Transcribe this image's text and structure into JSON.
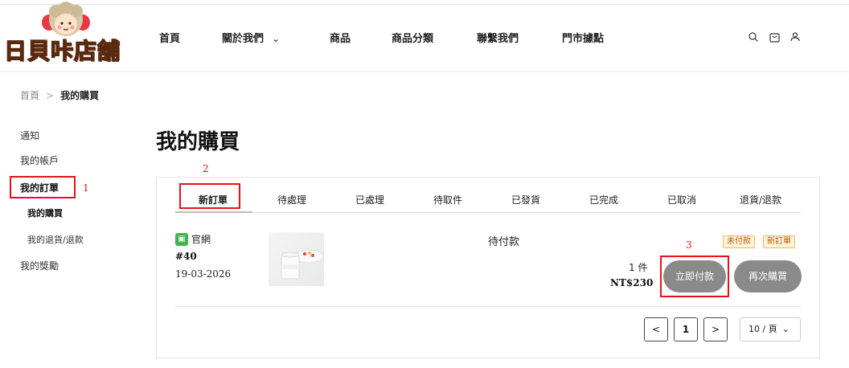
{
  "brand": {
    "logo_text": "日貝咔店舖",
    "accent": "#e53a46"
  },
  "nav": {
    "items": [
      {
        "label": "首頁"
      },
      {
        "label": "關於我們"
      },
      {
        "label": "商品"
      },
      {
        "label": "商品分類"
      },
      {
        "label": "聯繫我們"
      },
      {
        "label": "門市據點"
      }
    ],
    "dropdown_icon": "chevron-down-icon",
    "icons": [
      "search-icon",
      "cart-icon",
      "user-icon"
    ]
  },
  "breadcrumb": {
    "home": "首頁",
    "separator": ">",
    "current": "我的購買"
  },
  "sidebar": {
    "items": [
      {
        "label": "通知"
      },
      {
        "label": "我的帳戶"
      },
      {
        "label": "我的訂單"
      },
      {
        "label": "我的購買"
      },
      {
        "label": "我的退貨/退款"
      },
      {
        "label": "我的獎勵"
      }
    ]
  },
  "page_title": "我的購買",
  "tabs": [
    {
      "label": "新訂單"
    },
    {
      "label": "待處理"
    },
    {
      "label": "已處理"
    },
    {
      "label": "待取件"
    },
    {
      "label": "已發貨"
    },
    {
      "label": "已完成"
    },
    {
      "label": "已取消"
    },
    {
      "label": "退貨/退款"
    }
  ],
  "order": {
    "channel_icon": "store-icon",
    "channel": "官網",
    "number": "#40",
    "date": "19-03-2026",
    "status": "待付款",
    "badges": [
      "未付款",
      "新訂單"
    ],
    "quantity": "1 件",
    "total": "NT$230",
    "pay_button": "立即付款",
    "reorder_button": "再次購買"
  },
  "pagination": {
    "prev": "<",
    "current": "1",
    "next": ">",
    "page_size": "10 / 頁"
  },
  "annotations": [
    "1",
    "2",
    "3"
  ],
  "colors": {
    "annotation_red": "#e8101a",
    "button_grey": "#8a8a8a",
    "badge_orange": "#f3b85a"
  }
}
